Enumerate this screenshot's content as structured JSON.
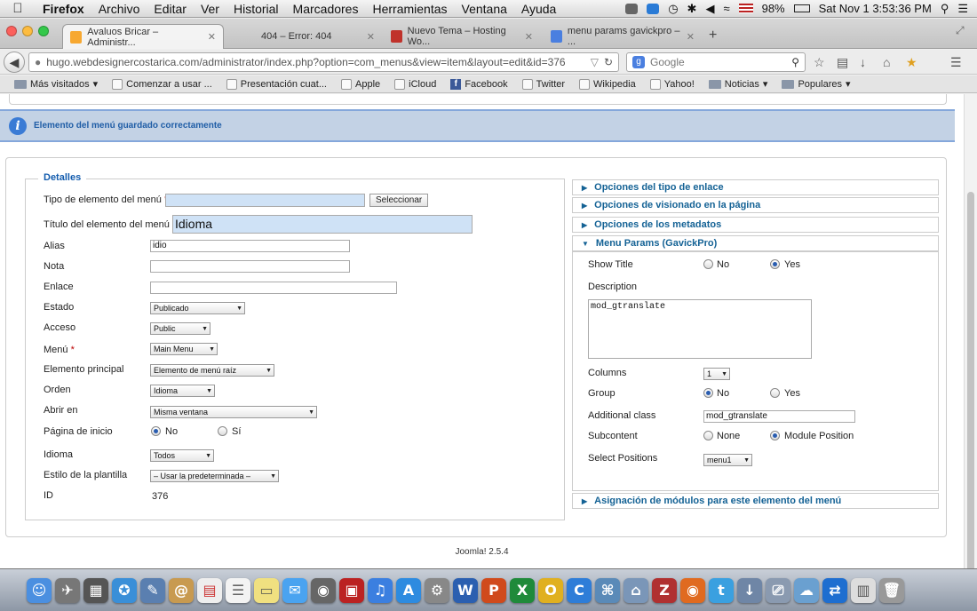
{
  "menubar": {
    "app": "Firefox",
    "items": [
      "Archivo",
      "Editar",
      "Ver",
      "Historial",
      "Marcadores",
      "Herramientas",
      "Ventana",
      "Ayuda"
    ],
    "battery": "98%",
    "clock": "Sat Nov 1  3:53:36 PM"
  },
  "tabs": [
    {
      "title": "Avaluos Bricar – Administr...",
      "active": true
    },
    {
      "title": "404 – Error: 404",
      "active": false
    },
    {
      "title": "Nuevo Tema – Hosting Wo...",
      "active": false
    },
    {
      "title": "menu params gavickpro – ...",
      "active": false
    }
  ],
  "nav": {
    "url": "hugo.webdesignercostarica.com/administrator/index.php?option=com_menus&view=item&layout=edit&id=376",
    "search_placeholder": "Google"
  },
  "bookmarks": [
    "Más visitados",
    "Comenzar a usar ...",
    "Presentación cuat...",
    "Apple",
    "iCloud",
    "Facebook",
    "Twitter",
    "Wikipedia",
    "Yahoo!",
    "Noticias",
    "Populares"
  ],
  "message": "Elemento del menú guardado correctamente",
  "details": {
    "legend": "Detalles",
    "tipo_label": "Tipo de elemento del menú",
    "tipo_value": "",
    "select_button": "Seleccionar",
    "titulo_label": "Título del elemento del menú",
    "titulo_value": "Idioma",
    "alias_label": "Alias",
    "alias_value": "idio",
    "nota_label": "Nota",
    "nota_value": "",
    "enlace_label": "Enlace",
    "enlace_value": "",
    "estado_label": "Estado",
    "estado_value": "Publicado",
    "acceso_label": "Acceso",
    "acceso_value": "Public",
    "menu_label": "Menú",
    "menu_value": "Main Menu",
    "principal_label": "Elemento principal",
    "principal_value": "Elemento de menú raíz",
    "orden_label": "Orden",
    "orden_value": "Idioma",
    "abrir_label": "Abrir en",
    "abrir_value": "Misma ventana",
    "inicio_label": "Página de inicio",
    "inicio_no": "No",
    "inicio_si": "Sí",
    "idioma_label": "Idioma",
    "idioma_value": "Todos",
    "estilo_label": "Estilo de la plantilla",
    "estilo_value": "– Usar la predeterminada –",
    "id_label": "ID",
    "id_value": "376"
  },
  "panels": {
    "enlace": "Opciones del tipo de enlace",
    "visionado": "Opciones de visionado en la página",
    "metadatos": "Opciones de los metadatos",
    "gavick": "Menu Params (GavickPro)",
    "asignacion": "Asignación de módulos para este elemento del menú"
  },
  "gavick": {
    "show_title_label": "Show Title",
    "no": "No",
    "yes": "Yes",
    "description_label": "Description",
    "description_value": "mod_gtranslate",
    "columns_label": "Columns",
    "columns_value": "1",
    "group_label": "Group",
    "additional_label": "Additional class",
    "additional_value": "mod_gtranslate",
    "subcontent_label": "Subcontent",
    "none": "None",
    "module_position": "Module Position",
    "positions_label": "Select Positions",
    "positions_value": "menu1"
  },
  "footer": "Joomla! 2.5.4"
}
